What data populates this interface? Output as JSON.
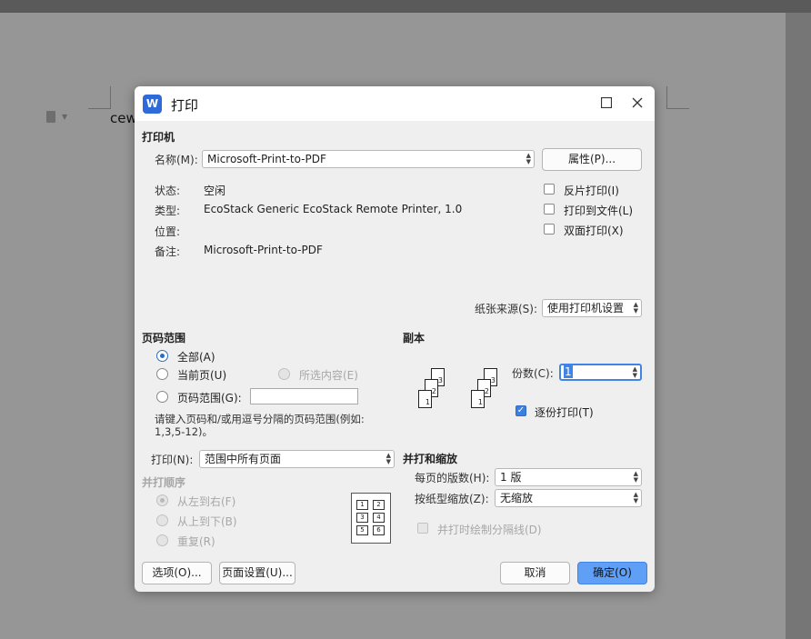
{
  "document": {
    "text": "cew"
  },
  "dialog": {
    "title": "打印",
    "app_icon_glyph": "W",
    "printer": {
      "section": "打印机",
      "name_label": "名称(M):",
      "name_value": "Microsoft-Print-to-PDF",
      "properties_button": "属性(P)...",
      "status_label": "状态:",
      "status_value": "空闲",
      "type_label": "类型:",
      "type_value": "EcoStack Generic EcoStack Remote Printer, 1.0",
      "location_label": "位置:",
      "location_value": "",
      "comment_label": "备注:",
      "comment_value": "Microsoft-Print-to-PDF",
      "reverse_print": "反片打印(I)",
      "print_to_file": "打印到文件(L)",
      "duplex": "双面打印(X)",
      "paper_source_label": "纸张来源(S):",
      "paper_source_value": "使用打印机设置"
    },
    "page_range": {
      "section": "页码范围",
      "all": "全部(A)",
      "current": "当前页(U)",
      "selection": "所选内容(E)",
      "pages": "页码范围(G):",
      "pages_value": "",
      "hint_line1": "请键入页码和/或用逗号分隔的页码范围(例如:",
      "hint_line2": "1,3,5-12)。"
    },
    "copies": {
      "section": "副本",
      "count_label": "份数(C):",
      "count_value": "1",
      "collate": "逐份打印(T)",
      "stack_a": [
        "1",
        "2",
        "3"
      ],
      "stack_b": [
        "1",
        "2",
        "3"
      ]
    },
    "print_what": {
      "label": "打印(N):",
      "value": "范围中所有页面"
    },
    "order": {
      "section": "并打顺序",
      "left_right": "从左到右(F)",
      "top_bottom": "从上到下(B)",
      "repeat": "重复(R)",
      "cells": [
        "1",
        "2",
        "3",
        "4",
        "5",
        "6"
      ]
    },
    "zoom": {
      "section": "并打和缩放",
      "pages_per_sheet_label": "每页的版数(H):",
      "pages_per_sheet_value": "1 版",
      "scale_label": "按纸型缩放(Z):",
      "scale_value": "无缩放",
      "draw_borders": "并打时绘制分隔线(D)"
    },
    "footer": {
      "options": "选项(O)...",
      "page_setup": "页面设置(U)...",
      "cancel": "取消",
      "ok": "确定(O)"
    }
  }
}
